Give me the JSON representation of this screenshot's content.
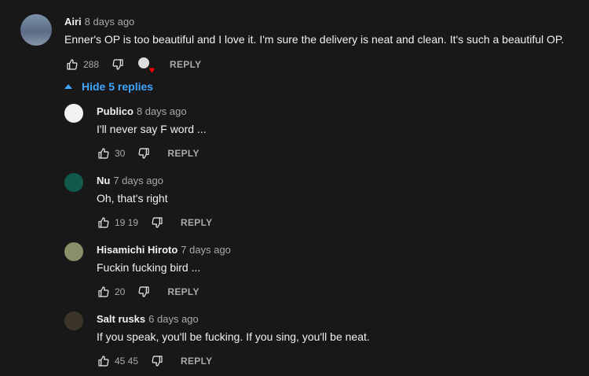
{
  "toggle": {
    "label": "Hide 5 replies"
  },
  "reply_label": "REPLY",
  "top_comment": {
    "author": "Airi",
    "time": "8 days ago",
    "text": "Enner's OP is too beautiful and I love it. I'm sure the delivery is neat and clean. It's such a beautiful OP.",
    "likes": "288",
    "hearted": true,
    "avatar_color": "#6d7f99"
  },
  "replies": [
    {
      "author": "Publico",
      "time": "8 days ago",
      "text": "I'll never say F word ...",
      "likes": "30",
      "avatar_color": "#f2f2f2"
    },
    {
      "author": "Nu",
      "time": "7 days ago",
      "text": "Oh, that's right",
      "likes": "19 19",
      "avatar_color": "#0f5a4a"
    },
    {
      "author": "Hisamichi Hiroto",
      "time": "7 days ago",
      "text": "Fuckin fucking bird ...",
      "likes": "20",
      "avatar_color": "#8a8f6a"
    },
    {
      "author": "Salt rusks",
      "time": "6 days ago",
      "text": "If you speak, you'll be fucking. If you sing, you'll be neat.",
      "likes": "45 45",
      "avatar_color": "#3b3528"
    }
  ]
}
